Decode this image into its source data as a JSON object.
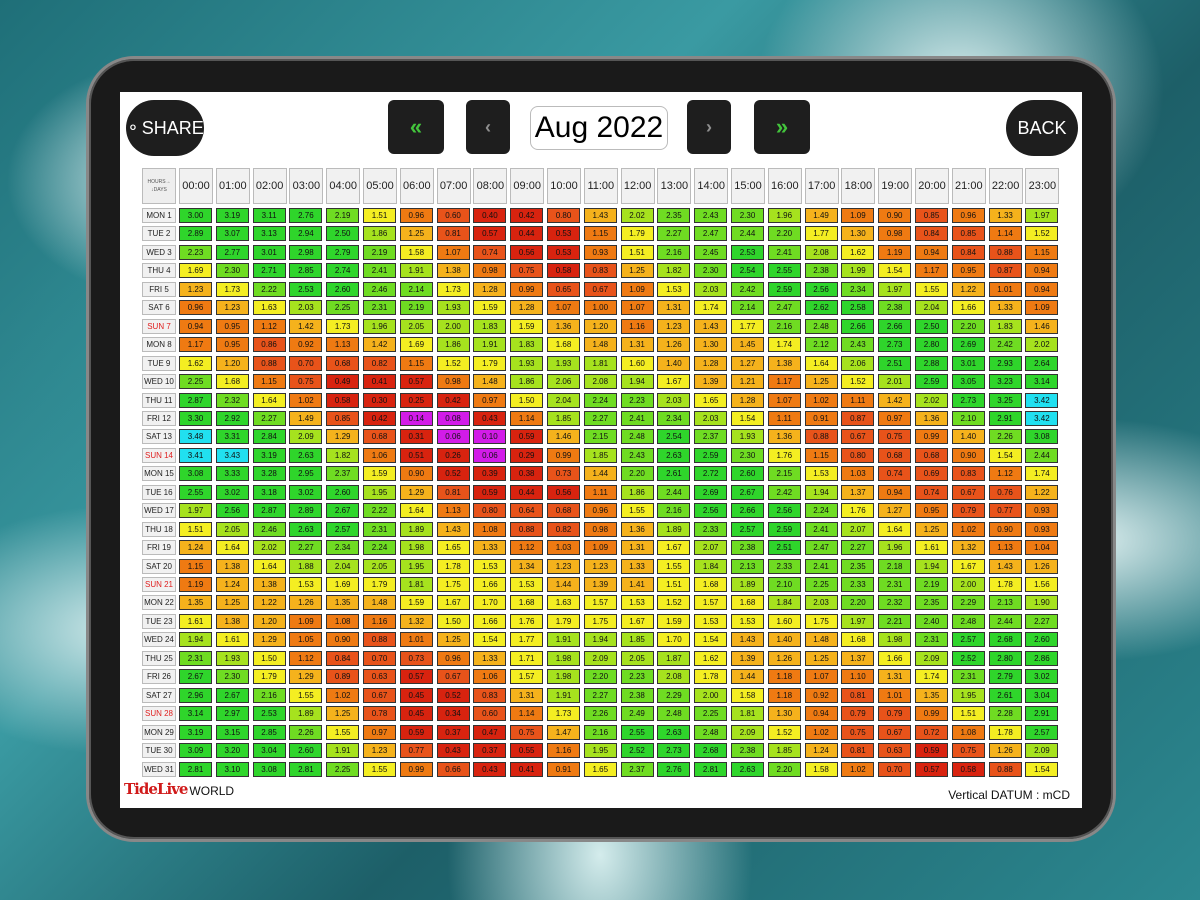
{
  "header": {
    "share_label": "SHARE",
    "back_label": "BACK",
    "month": "Aug 2022",
    "nav_prev_fast": "«",
    "nav_prev": "‹",
    "nav_next": "›",
    "nav_next_fast": "»"
  },
  "table": {
    "corner_top": "HOURS→",
    "corner_bottom": "↓DAYS",
    "hours": [
      "00:00",
      "01:00",
      "02:00",
      "03:00",
      "04:00",
      "05:00",
      "06:00",
      "07:00",
      "08:00",
      "09:00",
      "10:00",
      "11:00",
      "12:00",
      "13:00",
      "14:00",
      "15:00",
      "16:00",
      "17:00",
      "18:00",
      "19:00",
      "20:00",
      "21:00",
      "22:00",
      "23:00"
    ],
    "days": [
      "MON 1",
      "TUE 2",
      "WED 3",
      "THU 4",
      "FRI 5",
      "SAT 6",
      "SUN 7",
      "MON 8",
      "TUE 9",
      "WED 10",
      "THU 11",
      "FRI 12",
      "SAT 13",
      "SUN 14",
      "MON 15",
      "TUE 16",
      "WED 17",
      "THU 18",
      "FRI 19",
      "SAT 20",
      "SUN 21",
      "MON 22",
      "TUE 23",
      "WED 24",
      "THU 25",
      "FRI 26",
      "SAT 27",
      "SUN 28",
      "MON 29",
      "TUE 30",
      "WED 31"
    ],
    "rows": [
      [
        "3.00",
        "3.19",
        "3.11",
        "2.76",
        "2.19",
        "1.51",
        "0.96",
        "0.60",
        "0.40",
        "0.42",
        "0.80",
        "1.43",
        "2.02",
        "2.35",
        "2.43",
        "2.30",
        "1.96",
        "1.49",
        "1.09",
        "0.90",
        "0.85",
        "0.96",
        "1.33",
        "1.97"
      ],
      [
        "2.89",
        "3.07",
        "3.13",
        "2.94",
        "2.50",
        "1.86",
        "1.25",
        "0.81",
        "0.57",
        "0.44",
        "0.53",
        "1.15",
        "1.79",
        "2.27",
        "2.47",
        "2.44",
        "2.20",
        "1.77",
        "1.30",
        "0.98",
        "0.84",
        "0.85",
        "1.14",
        "1.52"
      ],
      [
        "2.23",
        "2.77",
        "3.01",
        "2.98",
        "2.79",
        "2.19",
        "1.58",
        "1.07",
        "0.74",
        "0.56",
        "0.53",
        "0.93",
        "1.51",
        "2.16",
        "2.45",
        "2.53",
        "2.41",
        "2.08",
        "1.62",
        "1.19",
        "0.94",
        "0.84",
        "0.88",
        "1.15"
      ],
      [
        "1.69",
        "2.30",
        "2.71",
        "2.85",
        "2.74",
        "2.41",
        "1.91",
        "1.38",
        "0.98",
        "0.75",
        "0.58",
        "0.83",
        "1.25",
        "1.82",
        "2.30",
        "2.54",
        "2.55",
        "2.38",
        "1.99",
        "1.54",
        "1.17",
        "0.95",
        "0.87",
        "0.94"
      ],
      [
        "1.23",
        "1.73",
        "2.22",
        "2.53",
        "2.60",
        "2.46",
        "2.14",
        "1.73",
        "1.28",
        "0.99",
        "0.65",
        "0.67",
        "1.09",
        "1.53",
        "2.03",
        "2.42",
        "2.59",
        "2.56",
        "2.34",
        "1.97",
        "1.55",
        "1.22",
        "1.01",
        "0.94"
      ],
      [
        "0.96",
        "1.23",
        "1.63",
        "2.03",
        "2.25",
        "2.31",
        "2.19",
        "1.93",
        "1.59",
        "1.28",
        "1.07",
        "1.00",
        "1.07",
        "1.31",
        "1.74",
        "2.14",
        "2.47",
        "2.62",
        "2.58",
        "2.38",
        "2.04",
        "1.66",
        "1.33",
        "1.09"
      ],
      [
        "0.94",
        "0.95",
        "1.12",
        "1.42",
        "1.73",
        "1.96",
        "2.05",
        "2.00",
        "1.83",
        "1.59",
        "1.36",
        "1.20",
        "1.16",
        "1.23",
        "1.43",
        "1.77",
        "2.16",
        "2.48",
        "2.66",
        "2.66",
        "2.50",
        "2.20",
        "1.83",
        "1.46"
      ],
      [
        "1.17",
        "0.95",
        "0.86",
        "0.92",
        "1.13",
        "1.42",
        "1.69",
        "1.86",
        "1.91",
        "1.83",
        "1.68",
        "1.48",
        "1.31",
        "1.26",
        "1.30",
        "1.45",
        "1.74",
        "2.12",
        "2.43",
        "2.73",
        "2.80",
        "2.69",
        "2.42",
        "2.02"
      ],
      [
        "1.62",
        "1.20",
        "0.88",
        "0.70",
        "0.68",
        "0.82",
        "1.15",
        "1.52",
        "1.79",
        "1.93",
        "1.93",
        "1.81",
        "1.60",
        "1.40",
        "1.28",
        "1.27",
        "1.38",
        "1.64",
        "2.06",
        "2.51",
        "2.88",
        "3.01",
        "2.93",
        "2.64"
      ],
      [
        "2.25",
        "1.68",
        "1.15",
        "0.75",
        "0.49",
        "0.41",
        "0.57",
        "0.98",
        "1.48",
        "1.86",
        "2.06",
        "2.08",
        "1.94",
        "1.67",
        "1.39",
        "1.21",
        "1.17",
        "1.25",
        "1.52",
        "2.01",
        "2.59",
        "3.05",
        "3.23",
        "3.14"
      ],
      [
        "2.87",
        "2.32",
        "1.64",
        "1.02",
        "0.58",
        "0.30",
        "0.25",
        "0.42",
        "0.97",
        "1.50",
        "2.04",
        "2.24",
        "2.23",
        "2.03",
        "1.65",
        "1.28",
        "1.07",
        "1.02",
        "1.11",
        "1.42",
        "2.02",
        "2.73",
        "3.25",
        "3.42"
      ],
      [
        "3.30",
        "2.92",
        "2.27",
        "1.49",
        "0.85",
        "0.42",
        "0.14",
        "0.08",
        "0.43",
        "1.14",
        "1.85",
        "2.27",
        "2.41",
        "2.34",
        "2.03",
        "1.54",
        "1.11",
        "0.91",
        "0.87",
        "0.97",
        "1.36",
        "2.10",
        "2.91",
        "3.42"
      ],
      [
        "3.48",
        "3.31",
        "2.84",
        "2.09",
        "1.29",
        "0.68",
        "0.31",
        "0.06",
        "0.10",
        "0.59",
        "1.46",
        "2.15",
        "2.48",
        "2.54",
        "2.37",
        "1.93",
        "1.36",
        "0.88",
        "0.67",
        "0.75",
        "0.99",
        "1.40",
        "2.26",
        "3.08"
      ],
      [
        "3.41",
        "3.43",
        "3.19",
        "2.63",
        "1.82",
        "1.06",
        "0.51",
        "0.26",
        "0.06",
        "0.29",
        "0.99",
        "1.85",
        "2.43",
        "2.63",
        "2.59",
        "2.30",
        "1.76",
        "1.15",
        "0.80",
        "0.68",
        "0.68",
        "0.90",
        "1.54",
        "2.44"
      ],
      [
        "3.08",
        "3.33",
        "3.28",
        "2.95",
        "2.37",
        "1.59",
        "0.90",
        "0.52",
        "0.39",
        "0.38",
        "0.73",
        "1.44",
        "2.20",
        "2.61",
        "2.72",
        "2.60",
        "2.15",
        "1.53",
        "1.03",
        "0.74",
        "0.69",
        "0.83",
        "1.12",
        "1.74"
      ],
      [
        "2.55",
        "3.02",
        "3.18",
        "3.02",
        "2.60",
        "1.95",
        "1.29",
        "0.81",
        "0.59",
        "0.44",
        "0.56",
        "1.11",
        "1.86",
        "2.44",
        "2.69",
        "2.67",
        "2.42",
        "1.94",
        "1.37",
        "0.94",
        "0.74",
        "0.67",
        "0.76",
        "1.22"
      ],
      [
        "1.97",
        "2.56",
        "2.87",
        "2.89",
        "2.67",
        "2.22",
        "1.64",
        "1.13",
        "0.80",
        "0.64",
        "0.68",
        "0.96",
        "1.55",
        "2.16",
        "2.56",
        "2.66",
        "2.56",
        "2.24",
        "1.76",
        "1.27",
        "0.95",
        "0.79",
        "0.77",
        "0.93"
      ],
      [
        "1.51",
        "2.05",
        "2.46",
        "2.63",
        "2.57",
        "2.31",
        "1.89",
        "1.43",
        "1.08",
        "0.88",
        "0.82",
        "0.98",
        "1.36",
        "1.89",
        "2.33",
        "2.57",
        "2.59",
        "2.41",
        "2.07",
        "1.64",
        "1.25",
        "1.02",
        "0.90",
        "0.93"
      ],
      [
        "1.24",
        "1.64",
        "2.02",
        "2.27",
        "2.34",
        "2.24",
        "1.98",
        "1.65",
        "1.33",
        "1.12",
        "1.03",
        "1.09",
        "1.31",
        "1.67",
        "2.07",
        "2.38",
        "2.51",
        "2.47",
        "2.27",
        "1.96",
        "1.61",
        "1.32",
        "1.13",
        "1.04"
      ],
      [
        "1.15",
        "1.38",
        "1.64",
        "1.88",
        "2.04",
        "2.05",
        "1.95",
        "1.78",
        "1.53",
        "1.34",
        "1.23",
        "1.23",
        "1.33",
        "1.55",
        "1.84",
        "2.13",
        "2.33",
        "2.41",
        "2.35",
        "2.18",
        "1.94",
        "1.67",
        "1.43",
        "1.26"
      ],
      [
        "1.19",
        "1.24",
        "1.38",
        "1.53",
        "1.69",
        "1.79",
        "1.81",
        "1.75",
        "1.66",
        "1.53",
        "1.44",
        "1.39",
        "1.41",
        "1.51",
        "1.68",
        "1.89",
        "2.10",
        "2.25",
        "2.33",
        "2.31",
        "2.19",
        "2.00",
        "1.78",
        "1.56"
      ],
      [
        "1.35",
        "1.25",
        "1.22",
        "1.26",
        "1.35",
        "1.48",
        "1.59",
        "1.67",
        "1.70",
        "1.68",
        "1.63",
        "1.57",
        "1.53",
        "1.52",
        "1.57",
        "1.68",
        "1.84",
        "2.03",
        "2.20",
        "2.32",
        "2.35",
        "2.29",
        "2.13",
        "1.90"
      ],
      [
        "1.61",
        "1.38",
        "1.20",
        "1.09",
        "1.08",
        "1.16",
        "1.32",
        "1.50",
        "1.66",
        "1.76",
        "1.79",
        "1.75",
        "1.67",
        "1.59",
        "1.53",
        "1.53",
        "1.60",
        "1.75",
        "1.97",
        "2.21",
        "2.40",
        "2.48",
        "2.44",
        "2.27"
      ],
      [
        "1.94",
        "1.61",
        "1.29",
        "1.05",
        "0.90",
        "0.88",
        "1.01",
        "1.25",
        "1.54",
        "1.77",
        "1.91",
        "1.94",
        "1.85",
        "1.70",
        "1.54",
        "1.43",
        "1.40",
        "1.48",
        "1.68",
        "1.98",
        "2.31",
        "2.57",
        "2.68",
        "2.60"
      ],
      [
        "2.31",
        "1.93",
        "1.50",
        "1.12",
        "0.84",
        "0.70",
        "0.73",
        "0.96",
        "1.33",
        "1.71",
        "1.98",
        "2.09",
        "2.05",
        "1.87",
        "1.62",
        "1.39",
        "1.26",
        "1.25",
        "1.37",
        "1.66",
        "2.09",
        "2.52",
        "2.80",
        "2.86"
      ],
      [
        "2.67",
        "2.30",
        "1.79",
        "1.29",
        "0.89",
        "0.63",
        "0.57",
        "0.67",
        "1.06",
        "1.57",
        "1.98",
        "2.20",
        "2.23",
        "2.08",
        "1.78",
        "1.44",
        "1.18",
        "1.07",
        "1.10",
        "1.31",
        "1.74",
        "2.31",
        "2.79",
        "3.02"
      ],
      [
        "2.96",
        "2.67",
        "2.16",
        "1.55",
        "1.02",
        "0.67",
        "0.45",
        "0.52",
        "0.83",
        "1.31",
        "1.91",
        "2.27",
        "2.38",
        "2.29",
        "2.00",
        "1.58",
        "1.18",
        "0.92",
        "0.81",
        "1.01",
        "1.35",
        "1.95",
        "2.61",
        "3.04"
      ],
      [
        "3.14",
        "2.97",
        "2.53",
        "1.89",
        "1.25",
        "0.78",
        "0.45",
        "0.34",
        "0.60",
        "1.14",
        "1.73",
        "2.26",
        "2.49",
        "2.48",
        "2.25",
        "1.81",
        "1.30",
        "0.94",
        "0.79",
        "0.79",
        "0.99",
        "1.51",
        "2.28",
        "2.91"
      ],
      [
        "3.19",
        "3.15",
        "2.85",
        "2.26",
        "1.55",
        "0.97",
        "0.59",
        "0.37",
        "0.47",
        "0.75",
        "1.47",
        "2.16",
        "2.55",
        "2.63",
        "2.48",
        "2.09",
        "1.52",
        "1.02",
        "0.75",
        "0.67",
        "0.72",
        "1.08",
        "1.78",
        "2.57"
      ],
      [
        "3.09",
        "3.20",
        "3.04",
        "2.60",
        "1.91",
        "1.23",
        "0.77",
        "0.43",
        "0.37",
        "0.55",
        "1.16",
        "1.95",
        "2.52",
        "2.73",
        "2.68",
        "2.38",
        "1.85",
        "1.24",
        "0.81",
        "0.63",
        "0.59",
        "0.75",
        "1.26",
        "2.09"
      ],
      [
        "2.81",
        "3.10",
        "3.08",
        "2.81",
        "2.25",
        "1.55",
        "0.99",
        "0.66",
        "0.43",
        "0.41",
        "0.91",
        "1.65",
        "2.37",
        "2.76",
        "2.81",
        "2.63",
        "2.20",
        "1.58",
        "1.02",
        "0.70",
        "0.57",
        "0.58",
        "0.88",
        "1.54"
      ]
    ]
  },
  "footer": {
    "logo_main": "TideLive",
    "logo_sub": "WORLD",
    "datum": "Vertical DATUM : mCD"
  },
  "colors": {
    "cyan": "#21e0f0",
    "magenta": "#d21ce8",
    "red": "#d8230f",
    "orange": "#ef7a12",
    "yellow": "#f4ee22",
    "lime": "#a6e21e",
    "green": "#2fd52b"
  }
}
